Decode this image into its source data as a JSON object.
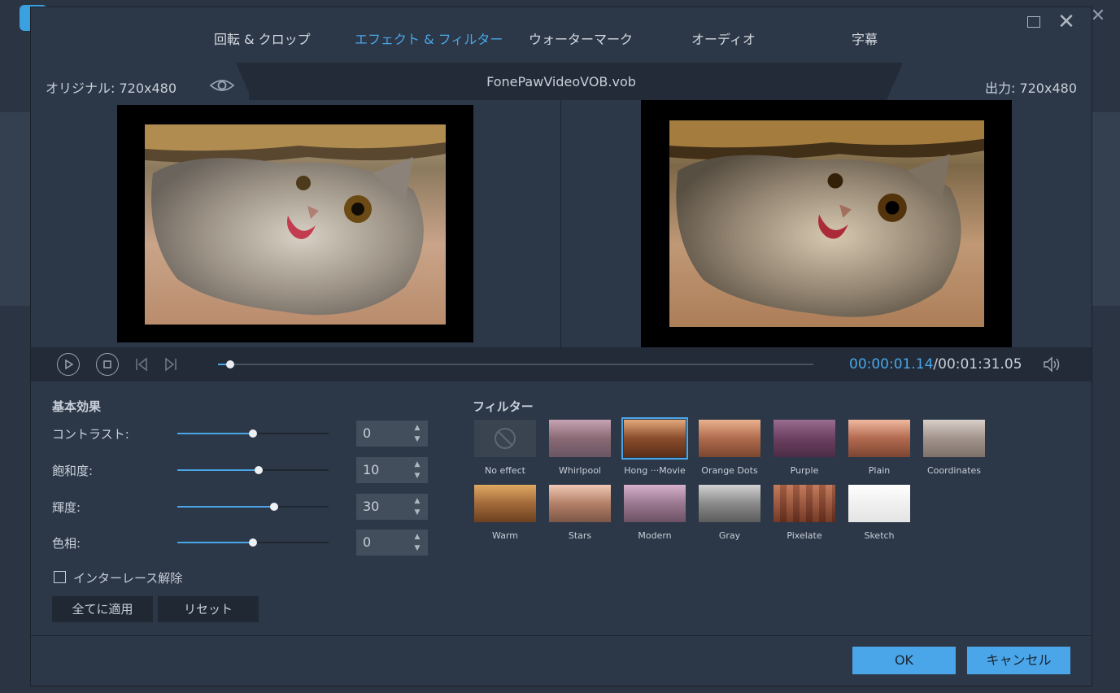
{
  "tabs": [
    {
      "label": "回転 & クロップ"
    },
    {
      "label": "エフェクト & フィルター"
    },
    {
      "label": "ウォーターマーク"
    },
    {
      "label": "オーディオ"
    },
    {
      "label": "字幕"
    }
  ],
  "active_tab": "エフェクト & フィルター",
  "preview": {
    "original_label": "オリジナル: 720x480",
    "file_name": "FonePawVideoVOB.vob",
    "output_label": "出力: 720x480"
  },
  "player": {
    "current_time": "00:00:01.14",
    "separator": "/",
    "total_time": "00:01:31.05",
    "progress_fraction": 0.02
  },
  "basic_effects": {
    "title": "基本効果",
    "items": [
      {
        "label": "コントラスト:",
        "value": "0",
        "slider_fraction": 0.5
      },
      {
        "label": "飽和度:",
        "value": "10",
        "slider_fraction": 0.54
      },
      {
        "label": "輝度:",
        "value": "30",
        "slider_fraction": 0.64
      },
      {
        "label": "色相:",
        "value": "0",
        "slider_fraction": 0.5
      }
    ],
    "deinterlace_label": "インターレース解除",
    "deinterlace_checked": false,
    "apply_all_label": "全てに適用",
    "reset_label": "リセット"
  },
  "filters": {
    "title": "フィルター",
    "selected": "Hong ···Movie",
    "items": [
      {
        "label": "No effect"
      },
      {
        "label": "Whirlpool"
      },
      {
        "label": "Hong ···Movie"
      },
      {
        "label": "Orange Dots"
      },
      {
        "label": "Purple"
      },
      {
        "label": "Plain"
      },
      {
        "label": "Coordinates"
      },
      {
        "label": "Warm"
      },
      {
        "label": "Stars"
      },
      {
        "label": "Modern"
      },
      {
        "label": "Gray"
      },
      {
        "label": "Pixelate"
      },
      {
        "label": "Sketch"
      }
    ]
  },
  "footer": {
    "ok_label": "OK",
    "cancel_label": "キャンセル"
  },
  "colors": {
    "accent": "#4aa6e8",
    "dialog_bg": "#2c3747",
    "dark_bar": "#222b37"
  }
}
